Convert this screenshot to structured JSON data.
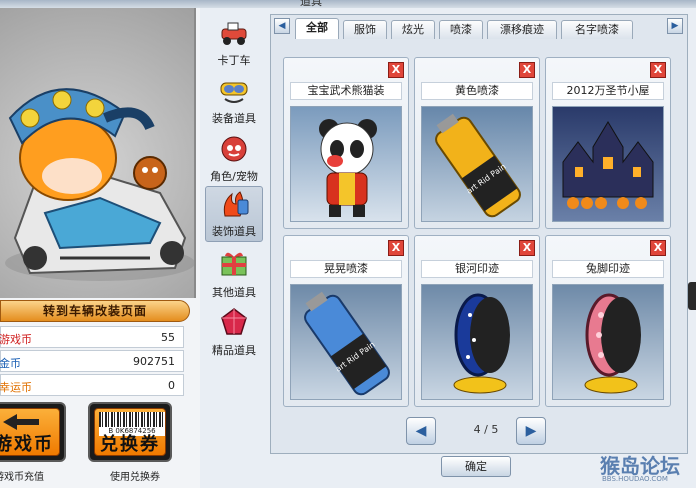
{
  "window": {
    "title": "道具"
  },
  "left": {
    "convert_button": "转到车辆改装页面",
    "stats": [
      {
        "label": "游戏币",
        "value": "55",
        "color": "#d02020"
      },
      {
        "label": "金币",
        "value": "902751",
        "color": "#1a5fb4"
      },
      {
        "label": "幸运币",
        "value": "0",
        "color": "#e07000"
      }
    ],
    "recharge": {
      "label": "游戏币",
      "caption": "游戏币充值"
    },
    "voucher": {
      "label": "兑换券",
      "barcode": "B 0K6874256",
      "caption": "使用兑换券"
    }
  },
  "categories": [
    {
      "label": "卡丁车",
      "icon": "kart-icon"
    },
    {
      "label": "装备道具",
      "icon": "goggles-icon"
    },
    {
      "label": "角色/宠物",
      "icon": "character-icon"
    },
    {
      "label": "装饰道具",
      "icon": "decoration-icon",
      "selected": true
    },
    {
      "label": "其他道具",
      "icon": "gift-box-icon"
    },
    {
      "label": "精品道具",
      "icon": "gem-icon"
    }
  ],
  "tabs": [
    {
      "label": "全部",
      "selected": true
    },
    {
      "label": "服饰"
    },
    {
      "label": "炫光"
    },
    {
      "label": "喷漆"
    },
    {
      "label": "漂移痕迹"
    },
    {
      "label": "名字喷漆"
    }
  ],
  "items": [
    {
      "name": "宝宝武术熊猫装",
      "icon": "panda-costume-icon"
    },
    {
      "name": "黄色喷漆",
      "icon": "yellow-spray-can-icon"
    },
    {
      "name": "2012万圣节小屋",
      "icon": "halloween-house-icon"
    },
    {
      "name": "晃晃喷漆",
      "icon": "blue-spray-can-icon"
    },
    {
      "name": "银河印迹",
      "icon": "galaxy-tire-icon"
    },
    {
      "name": "兔脚印迹",
      "icon": "rabbit-tire-icon"
    }
  ],
  "delete_label": "X",
  "can_label": "art Rid Pain",
  "pager": {
    "current": 4,
    "total": 5,
    "text": "4 / 5"
  },
  "confirm": "确定",
  "watermark": {
    "main": "猴岛论坛",
    "sub": "BBS.HOUDAO.COM"
  }
}
